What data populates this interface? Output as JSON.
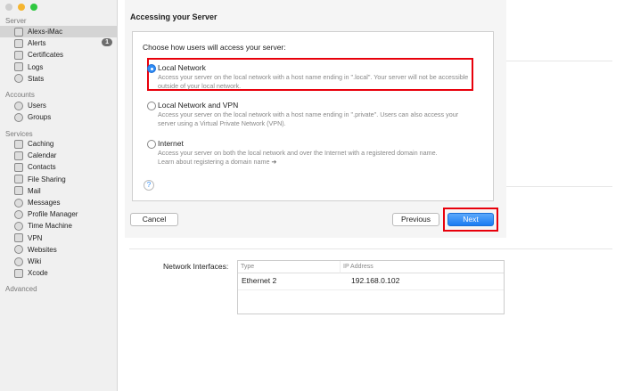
{
  "window": {
    "traffic_lights": [
      "#cfcfcf",
      "#f5b52f",
      "#2fc840"
    ]
  },
  "sidebar": {
    "sections": [
      {
        "label": "Server"
      },
      {
        "label": "Accounts"
      },
      {
        "label": "Services"
      },
      {
        "label": "Advanced"
      }
    ],
    "server_items": [
      {
        "label": "Alexs-iMac",
        "icon": "imac-icon",
        "selected": true
      },
      {
        "label": "Alerts",
        "icon": "megaphone-icon",
        "badge": "1"
      },
      {
        "label": "Certificates",
        "icon": "certificate-icon"
      },
      {
        "label": "Logs",
        "icon": "log-icon"
      },
      {
        "label": "Stats",
        "icon": "stats-icon"
      }
    ],
    "account_items": [
      {
        "label": "Users",
        "icon": "user-icon"
      },
      {
        "label": "Groups",
        "icon": "group-icon"
      }
    ],
    "service_items": [
      {
        "label": "Caching",
        "icon": "caching-icon"
      },
      {
        "label": "Calendar",
        "icon": "calendar-icon"
      },
      {
        "label": "Contacts",
        "icon": "contacts-icon"
      },
      {
        "label": "File Sharing",
        "icon": "folder-icon"
      },
      {
        "label": "Mail",
        "icon": "mail-icon"
      },
      {
        "label": "Messages",
        "icon": "messages-icon"
      },
      {
        "label": "Profile Manager",
        "icon": "profile-manager-icon"
      },
      {
        "label": "Time Machine",
        "icon": "time-machine-icon"
      },
      {
        "label": "VPN",
        "icon": "lock-icon"
      },
      {
        "label": "Websites",
        "icon": "globe-icon"
      },
      {
        "label": "Wiki",
        "icon": "wiki-icon"
      },
      {
        "label": "Xcode",
        "icon": "xcode-icon"
      }
    ]
  },
  "sheet": {
    "title": "Accessing your Server",
    "prompt": "Choose how users will access your server:",
    "options": [
      {
        "label": "Local Network",
        "selected": true,
        "description": "Access your server on the local network with a host name ending in \".local\". Your server will not be accessible outside of your local network."
      },
      {
        "label": "Local Network and VPN",
        "selected": false,
        "description": "Access your server on the local network with a host name ending in \".private\". Users can also access your server using a Virtual Private Network (VPN)."
      },
      {
        "label": "Internet",
        "selected": false,
        "description": "Access your server on both the local network and over the Internet with a registered domain name.",
        "link": "Learn about registering a domain name"
      }
    ],
    "help": "?",
    "cancel": "Cancel",
    "previous": "Previous",
    "next": "Next"
  },
  "network": {
    "label": "Network Interfaces:",
    "columns": [
      "Type",
      "IP Address"
    ],
    "rows": [
      [
        "Ethernet 2",
        "192.168.0.102"
      ]
    ]
  }
}
